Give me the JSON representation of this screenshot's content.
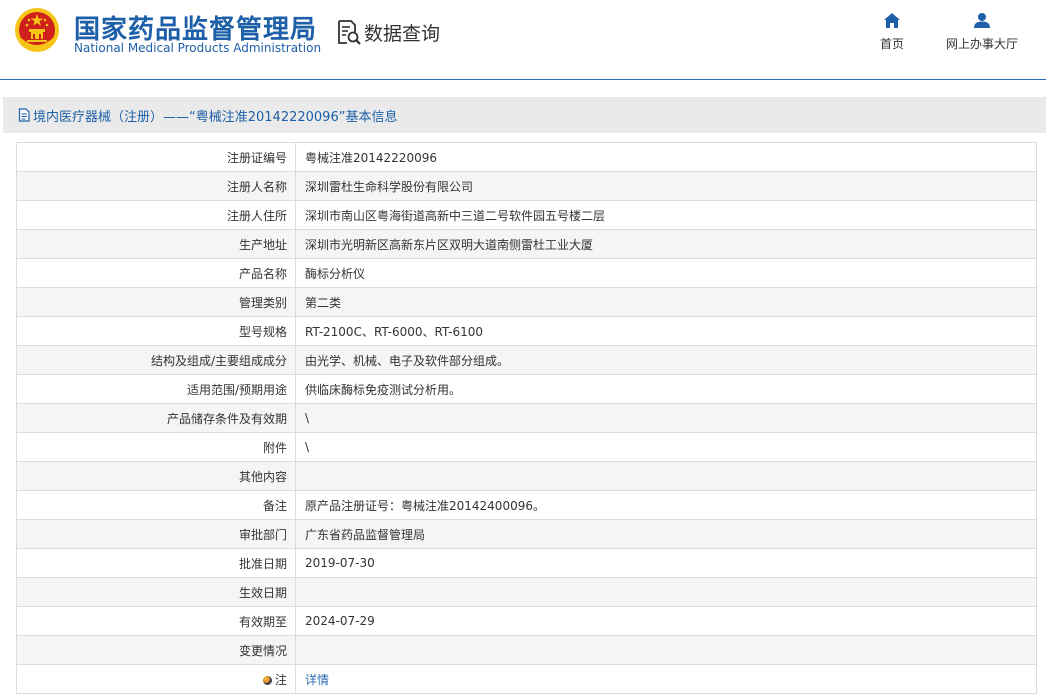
{
  "header": {
    "org_name_cn": "国家药品监督管理局",
    "org_name_en": "National Medical Products Administration",
    "section_title": "数据查询",
    "nav": [
      {
        "label": "首页",
        "icon": "home-icon"
      },
      {
        "label": "网上办事大厅",
        "icon": "user-icon"
      }
    ]
  },
  "colors": {
    "brand_blue": "#1d5fa8",
    "emblem_red": "#d0201c",
    "emblem_gold": "#f5c518",
    "title_bar_bg": "#eaeaea",
    "link": "#2d6db5"
  },
  "title_bar": {
    "text": "境内医疗器械（注册）——“粤械注准20142220096”基本信息"
  },
  "rows": [
    {
      "label": "注册证编号",
      "value": "粤械注准20142220096"
    },
    {
      "label": "注册人名称",
      "value": "深圳雷杜生命科学股份有限公司"
    },
    {
      "label": "注册人住所",
      "value": "深圳市南山区粤海街道高新中三道二号软件园五号楼二层"
    },
    {
      "label": "生产地址",
      "value": "深圳市光明新区高新东片区双明大道南侧雷杜工业大厦"
    },
    {
      "label": "产品名称",
      "value": "酶标分析仪"
    },
    {
      "label": "管理类别",
      "value": "第二类"
    },
    {
      "label": "型号规格",
      "value": "RT-2100C、RT-6000、RT-6100"
    },
    {
      "label": "结构及组成/主要组成成分",
      "value": "由光学、机械、电子及软件部分组成。"
    },
    {
      "label": "适用范围/预期用途",
      "value": "供临床酶标免疫测试分析用。"
    },
    {
      "label": "产品储存条件及有效期",
      "value": "\\"
    },
    {
      "label": "附件",
      "value": "\\"
    },
    {
      "label": "其他内容",
      "value": ""
    },
    {
      "label": "备注",
      "value": "原产品注册证号：粤械注准20142400096。"
    },
    {
      "label": "审批部门",
      "value": "广东省药品监督管理局"
    },
    {
      "label": "批准日期",
      "value": "2019-07-30"
    },
    {
      "label": "生效日期",
      "value": ""
    },
    {
      "label": "有效期至",
      "value": "2024-07-29"
    },
    {
      "label": "变更情况",
      "value": ""
    }
  ],
  "note_row": {
    "label": "注",
    "icon": "info-bulb-icon",
    "link_text": "详情"
  }
}
